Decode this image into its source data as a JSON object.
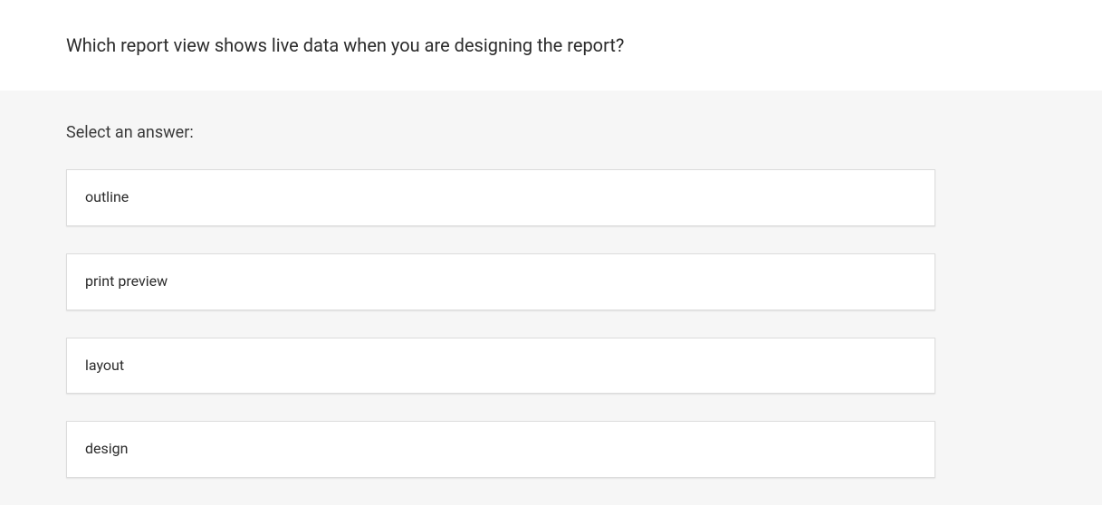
{
  "question": "Which report view shows live data when you are designing the report?",
  "prompt": "Select an answer:",
  "options": [
    "outline",
    "print preview",
    "layout",
    "design"
  ]
}
